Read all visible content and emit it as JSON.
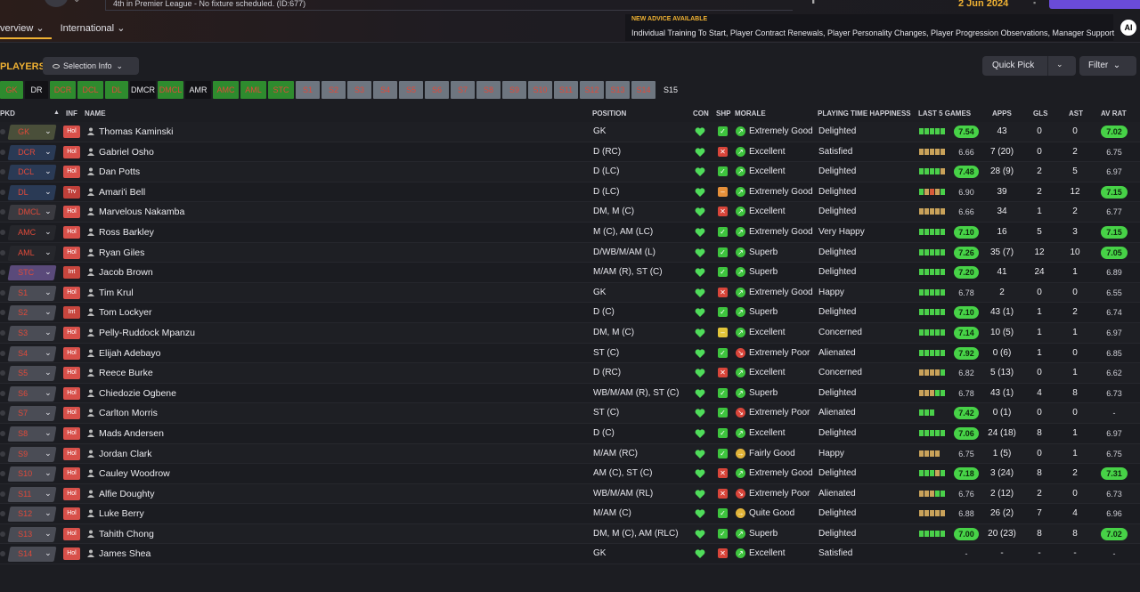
{
  "top": {
    "news_text": "4th in Premier League - No fixture scheduled. (ID:677)",
    "date": "2 Jun 2024",
    "tabs": [
      "verview",
      "International"
    ],
    "advice_title": "NEW ADVICE AVAILABLE",
    "advice_text": "Individual Training To Start, Player Contract Renewals, Player Personality Changes, Player Progression Observations, Manager Support",
    "ai_label": "AI"
  },
  "toolbar": {
    "players_title": "PLAYERS",
    "selection_info": "Selection Info",
    "quick_pick": "Quick Pick",
    "filter": "Filter"
  },
  "positions": [
    {
      "label": "GK",
      "style": "green"
    },
    {
      "label": "DR",
      "style": "black"
    },
    {
      "label": "DCR",
      "style": "green"
    },
    {
      "label": "DCL",
      "style": "green"
    },
    {
      "label": "DL",
      "style": "green"
    },
    {
      "label": "DMCR",
      "style": "black"
    },
    {
      "label": "DMCL",
      "style": "green"
    },
    {
      "label": "AMR",
      "style": "black"
    },
    {
      "label": "AMC",
      "style": "green"
    },
    {
      "label": "AML",
      "style": "green"
    },
    {
      "label": "STC",
      "style": "green"
    },
    {
      "label": "S1",
      "style": "grey"
    },
    {
      "label": "S2",
      "style": "grey"
    },
    {
      "label": "S3",
      "style": "grey"
    },
    {
      "label": "S4",
      "style": "grey"
    },
    {
      "label": "S5",
      "style": "grey"
    },
    {
      "label": "S6",
      "style": "grey"
    },
    {
      "label": "S7",
      "style": "grey"
    },
    {
      "label": "S8",
      "style": "grey"
    },
    {
      "label": "S9",
      "style": "grey"
    },
    {
      "label": "S10",
      "style": "grey"
    },
    {
      "label": "S11",
      "style": "grey"
    },
    {
      "label": "S12",
      "style": "grey"
    },
    {
      "label": "S13",
      "style": "grey"
    },
    {
      "label": "S14",
      "style": "grey"
    },
    {
      "label": "S15",
      "style": "plain"
    }
  ],
  "columns": {
    "pkd": "PKD",
    "inf": "INF",
    "name": "NAME",
    "position": "POSITION",
    "con": "CON",
    "shp": "SHP",
    "morale": "MORALE",
    "pth": "PLAYING TIME HAPPINESS",
    "last5": "LAST 5 GAMES",
    "apps": "APPS",
    "gls": "GLS",
    "ast": "AST",
    "avrat": "AV RAT"
  },
  "colors": {
    "accent": "#f0b233",
    "rating_high": "#47d247",
    "green": "#4ad04a",
    "red": "#d85a3a"
  },
  "players": [
    {
      "sel": "GK",
      "selc": "#4a4f3a",
      "inf": "Hol",
      "name": "Thomas Kaminski",
      "pos": "GK",
      "shp": "good",
      "mood": "up",
      "morale": "Extremely Good",
      "pth": "Delighted",
      "l5": "ggggg",
      "rating": "7.54",
      "rhi": true,
      "apps": "43",
      "gls": "0",
      "ast": "0",
      "avr": "7.02",
      "ahi": true
    },
    {
      "sel": "DCR",
      "selc": "#2a3a55",
      "inf": "Hol",
      "name": "Gabriel Osho",
      "pos": "D (RC)",
      "shp": "bad",
      "mood": "up",
      "morale": "Excellent",
      "pth": "Satisfied",
      "l5": "ooooo",
      "rating": "6.66",
      "rhi": false,
      "apps": "7 (20)",
      "gls": "0",
      "ast": "2",
      "avr": "6.75",
      "ahi": false
    },
    {
      "sel": "DCL",
      "selc": "#2a3a55",
      "inf": "Hol",
      "name": "Dan Potts",
      "pos": "D (LC)",
      "shp": "good",
      "mood": "up",
      "morale": "Excellent",
      "pth": "Delighted",
      "l5": "ggggo",
      "rating": "7.48",
      "rhi": true,
      "apps": "28 (9)",
      "gls": "2",
      "ast": "5",
      "avr": "6.97",
      "ahi": false
    },
    {
      "sel": "DL",
      "selc": "#2a3a55",
      "inf": "Trv",
      "name": "Amari'i Bell",
      "pos": "D (LC)",
      "shp": "warn",
      "mood": "up",
      "morale": "Extremely Good",
      "pth": "Delighted",
      "l5": "gorog",
      "rating": "6.90",
      "rhi": false,
      "apps": "39",
      "gls": "2",
      "ast": "12",
      "avr": "7.15",
      "ahi": true
    },
    {
      "sel": "DMCL",
      "selc": "#3a3a40",
      "inf": "Hol",
      "name": "Marvelous Nakamba",
      "pos": "DM, M (C)",
      "shp": "bad",
      "mood": "up",
      "morale": "Excellent",
      "pth": "Delighted",
      "l5": "ooooo",
      "rating": "6.66",
      "rhi": false,
      "apps": "34",
      "gls": "1",
      "ast": "2",
      "avr": "6.77",
      "ahi": false
    },
    {
      "sel": "AMC",
      "selc": "#26272c",
      "inf": "Hol",
      "name": "Ross Barkley",
      "pos": "M (C), AM (LC)",
      "shp": "good",
      "mood": "up",
      "morale": "Extremely Good",
      "pth": "Very Happy",
      "l5": "ggggg",
      "rating": "7.10",
      "rhi": true,
      "apps": "16",
      "gls": "5",
      "ast": "3",
      "avr": "7.15",
      "ahi": true
    },
    {
      "sel": "AML",
      "selc": "#26272c",
      "inf": "Hol",
      "name": "Ryan Giles",
      "pos": "D/WB/M/AM (L)",
      "shp": "good",
      "mood": "up",
      "morale": "Superb",
      "pth": "Delighted",
      "l5": "ggggg",
      "rating": "7.26",
      "rhi": true,
      "apps": "35 (7)",
      "gls": "12",
      "ast": "10",
      "avr": "7.05",
      "ahi": true
    },
    {
      "sel": "STC",
      "selc": "#5a4a7a",
      "inf": "Int",
      "name": "Jacob Brown",
      "pos": "M/AM (R), ST (C)",
      "shp": "good",
      "mood": "up",
      "morale": "Superb",
      "pth": "Delighted",
      "l5": "ggggg",
      "rating": "7.20",
      "rhi": true,
      "apps": "41",
      "gls": "24",
      "ast": "1",
      "avr": "6.89",
      "ahi": false
    },
    {
      "sel": "S1",
      "selc": "#4a4c55",
      "inf": "Hol",
      "name": "Tim Krul",
      "pos": "GK",
      "shp": "bad",
      "mood": "up",
      "morale": "Extremely Good",
      "pth": "Happy",
      "l5": "ggggg",
      "rating": "6.78",
      "rhi": false,
      "apps": "2",
      "gls": "0",
      "ast": "0",
      "avr": "6.55",
      "ahi": false
    },
    {
      "sel": "S2",
      "selc": "#4a4c55",
      "inf": "Int",
      "name": "Tom Lockyer",
      "pos": "D (C)",
      "shp": "good",
      "mood": "up",
      "morale": "Superb",
      "pth": "Delighted",
      "l5": "ggggg",
      "rating": "7.10",
      "rhi": true,
      "apps": "43 (1)",
      "gls": "1",
      "ast": "2",
      "avr": "6.74",
      "ahi": false
    },
    {
      "sel": "S3",
      "selc": "#4a4c55",
      "inf": "Hol",
      "name": "Pelly-Ruddock Mpanzu",
      "pos": "DM, M (C)",
      "shp": "neutral",
      "mood": "up",
      "morale": "Excellent",
      "pth": "Concerned",
      "l5": "ggggg",
      "rating": "7.14",
      "rhi": true,
      "apps": "10 (5)",
      "gls": "1",
      "ast": "1",
      "avr": "6.97",
      "ahi": false
    },
    {
      "sel": "S4",
      "selc": "#4a4c55",
      "inf": "Hol",
      "name": "Elijah Adebayo",
      "pos": "ST (C)",
      "shp": "good",
      "mood": "down",
      "morale": "Extremely Poor",
      "pth": "Alienated",
      "l5": "ggggg",
      "rating": "7.92",
      "rhi": true,
      "apps": "0 (6)",
      "gls": "1",
      "ast": "0",
      "avr": "6.85",
      "ahi": false
    },
    {
      "sel": "S5",
      "selc": "#4a4c55",
      "inf": "Hol",
      "name": "Reece Burke",
      "pos": "D (RC)",
      "shp": "bad",
      "mood": "up",
      "morale": "Excellent",
      "pth": "Concerned",
      "l5": "oooog",
      "rating": "6.82",
      "rhi": false,
      "apps": "5 (13)",
      "gls": "0",
      "ast": "1",
      "avr": "6.62",
      "ahi": false
    },
    {
      "sel": "S6",
      "selc": "#4a4c55",
      "inf": "Hol",
      "name": "Chiedozie Ogbene",
      "pos": "WB/M/AM (R), ST (C)",
      "shp": "good",
      "mood": "up",
      "morale": "Superb",
      "pth": "Delighted",
      "l5": "ooogg",
      "rating": "6.78",
      "rhi": false,
      "apps": "43 (1)",
      "gls": "4",
      "ast": "8",
      "avr": "6.73",
      "ahi": false
    },
    {
      "sel": "S7",
      "selc": "#4a4c55",
      "inf": "Hol",
      "name": "Carlton Morris",
      "pos": "ST (C)",
      "shp": "good",
      "mood": "down",
      "morale": "Extremely Poor",
      "pth": "Alienated",
      "l5": "ggg",
      "rating": "7.42",
      "rhi": true,
      "apps": "0 (1)",
      "gls": "0",
      "ast": "0",
      "avr": "-",
      "ahi": false
    },
    {
      "sel": "S8",
      "selc": "#4a4c55",
      "inf": "Hol",
      "name": "Mads Andersen",
      "pos": "D (C)",
      "shp": "good",
      "mood": "up",
      "morale": "Excellent",
      "pth": "Delighted",
      "l5": "ggggg",
      "rating": "7.06",
      "rhi": true,
      "apps": "24 (18)",
      "gls": "8",
      "ast": "1",
      "avr": "6.97",
      "ahi": false
    },
    {
      "sel": "S9",
      "selc": "#4a4c55",
      "inf": "Hol",
      "name": "Jordan Clark",
      "pos": "M/AM (RC)",
      "shp": "good",
      "mood": "neutral",
      "morale": "Fairly Good",
      "pth": "Happy",
      "l5": "oooo",
      "rating": "6.75",
      "rhi": false,
      "apps": "1 (5)",
      "gls": "0",
      "ast": "1",
      "avr": "6.75",
      "ahi": false
    },
    {
      "sel": "S10",
      "selc": "#4a4c55",
      "inf": "Hol",
      "name": "Cauley Woodrow",
      "pos": "AM (C), ST (C)",
      "shp": "bad",
      "mood": "up",
      "morale": "Extremely Good",
      "pth": "Delighted",
      "l5": "gggog",
      "rating": "7.18",
      "rhi": true,
      "apps": "3 (24)",
      "gls": "8",
      "ast": "2",
      "avr": "7.31",
      "ahi": true
    },
    {
      "sel": "S11",
      "selc": "#4a4c55",
      "inf": "Hol",
      "name": "Alfie Doughty",
      "pos": "WB/M/AM (RL)",
      "shp": "bad",
      "mood": "down",
      "morale": "Extremely Poor",
      "pth": "Alienated",
      "l5": "ooogg",
      "rating": "6.76",
      "rhi": false,
      "apps": "2 (12)",
      "gls": "2",
      "ast": "0",
      "avr": "6.73",
      "ahi": false
    },
    {
      "sel": "S12",
      "selc": "#4a4c55",
      "inf": "Hol",
      "name": "Luke Berry",
      "pos": "M/AM (C)",
      "shp": "good",
      "mood": "neutral",
      "morale": "Quite Good",
      "pth": "Delighted",
      "l5": "ooooo",
      "rating": "6.88",
      "rhi": false,
      "apps": "26 (2)",
      "gls": "7",
      "ast": "4",
      "avr": "6.96",
      "ahi": false
    },
    {
      "sel": "S13",
      "selc": "#4a4c55",
      "inf": "Hol",
      "name": "Tahith Chong",
      "pos": "DM, M (C), AM (RLC)",
      "shp": "good",
      "mood": "up",
      "morale": "Superb",
      "pth": "Delighted",
      "l5": "ggggg",
      "rating": "7.00",
      "rhi": true,
      "apps": "20 (23)",
      "gls": "8",
      "ast": "8",
      "avr": "7.02",
      "ahi": true
    },
    {
      "sel": "S14",
      "selc": "#4a4c55",
      "inf": "Hol",
      "name": "James Shea",
      "pos": "GK",
      "shp": "bad",
      "mood": "up",
      "morale": "Excellent",
      "pth": "Satisfied",
      "l5": "",
      "rating": "-",
      "rhi": false,
      "apps": "-",
      "gls": "-",
      "ast": "-",
      "avr": "-",
      "ahi": false
    }
  ]
}
